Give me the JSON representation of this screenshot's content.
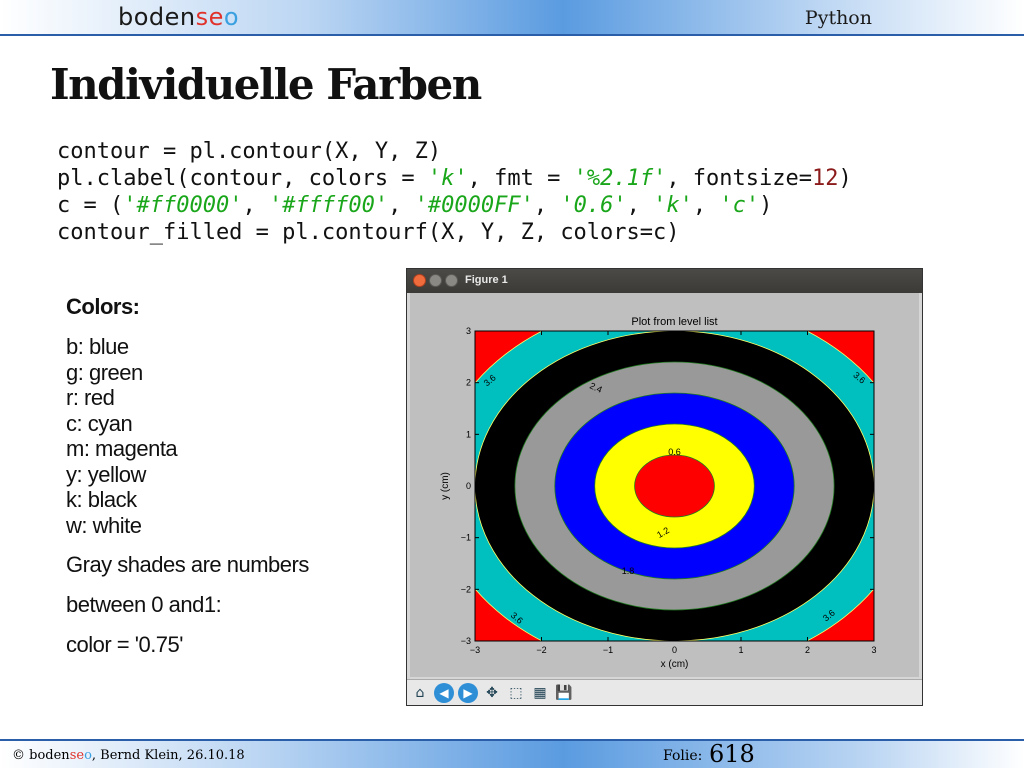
{
  "header": {
    "logo_a": "boden",
    "logo_b": "se",
    "logo_c": "o",
    "topic": "Python"
  },
  "slide_title": "Individuelle Farben",
  "code_lines": [
    "contour = pl.contour(X, Y, Z)",
    "pl.clabel(contour, colors = 'k', fmt = '%2.1f', fontsize=12)",
    "c = ('#ff0000', '#ffff00', '#0000FF', '0.6', 'k', 'c')",
    "contour_filled = pl.contourf(X, Y, Z, colors=c)"
  ],
  "colors_panel": {
    "heading": "Colors:",
    "items": [
      "b: blue",
      "g: green",
      "r: red",
      "c: cyan",
      "m: magenta",
      "y: yellow",
      "k: black",
      "w: white"
    ],
    "note1": "Gray shades are numbers",
    "note2": "between 0 and1:",
    "note3": "color = '0.75'"
  },
  "figure_window": {
    "title": "Figure 1",
    "toolbar_icons": [
      "home-icon",
      "back-icon",
      "forward-icon",
      "pan-icon",
      "zoom-icon",
      "configure-subplots-icon",
      "save-icon"
    ]
  },
  "chart_data": {
    "type": "contour",
    "title": "Plot from level list",
    "xlabel": "x (cm)",
    "ylabel": "y (cm)",
    "xlim": [
      -3,
      3
    ],
    "ylim": [
      -3,
      3
    ],
    "xticks": [
      "−3",
      "−2",
      "−1",
      "0",
      "1",
      "2",
      "3"
    ],
    "yticks": [
      "−3",
      "−2",
      "−1",
      "0",
      "1",
      "2",
      "3"
    ],
    "levels": [
      0.6,
      1.2,
      1.8,
      2.4,
      3.0,
      3.6
    ],
    "fill_colors": [
      "#ff0000",
      "#ffff00",
      "#0000ff",
      "#999999",
      "#000000",
      "#00bfbf",
      "#ff0000"
    ],
    "contour_labels": [
      "0.6",
      "1.2",
      "1.8",
      "2.4",
      "3.0",
      "3.6",
      "3.6",
      "3.6",
      "3.6"
    ]
  },
  "footer": {
    "copyright": "© ",
    "brand_a": "boden",
    "brand_b": "se",
    "brand_c": "o",
    "author_date": ", Bernd Klein, 26.10.18",
    "folie_label": "Folie:",
    "folie_number": "618"
  }
}
